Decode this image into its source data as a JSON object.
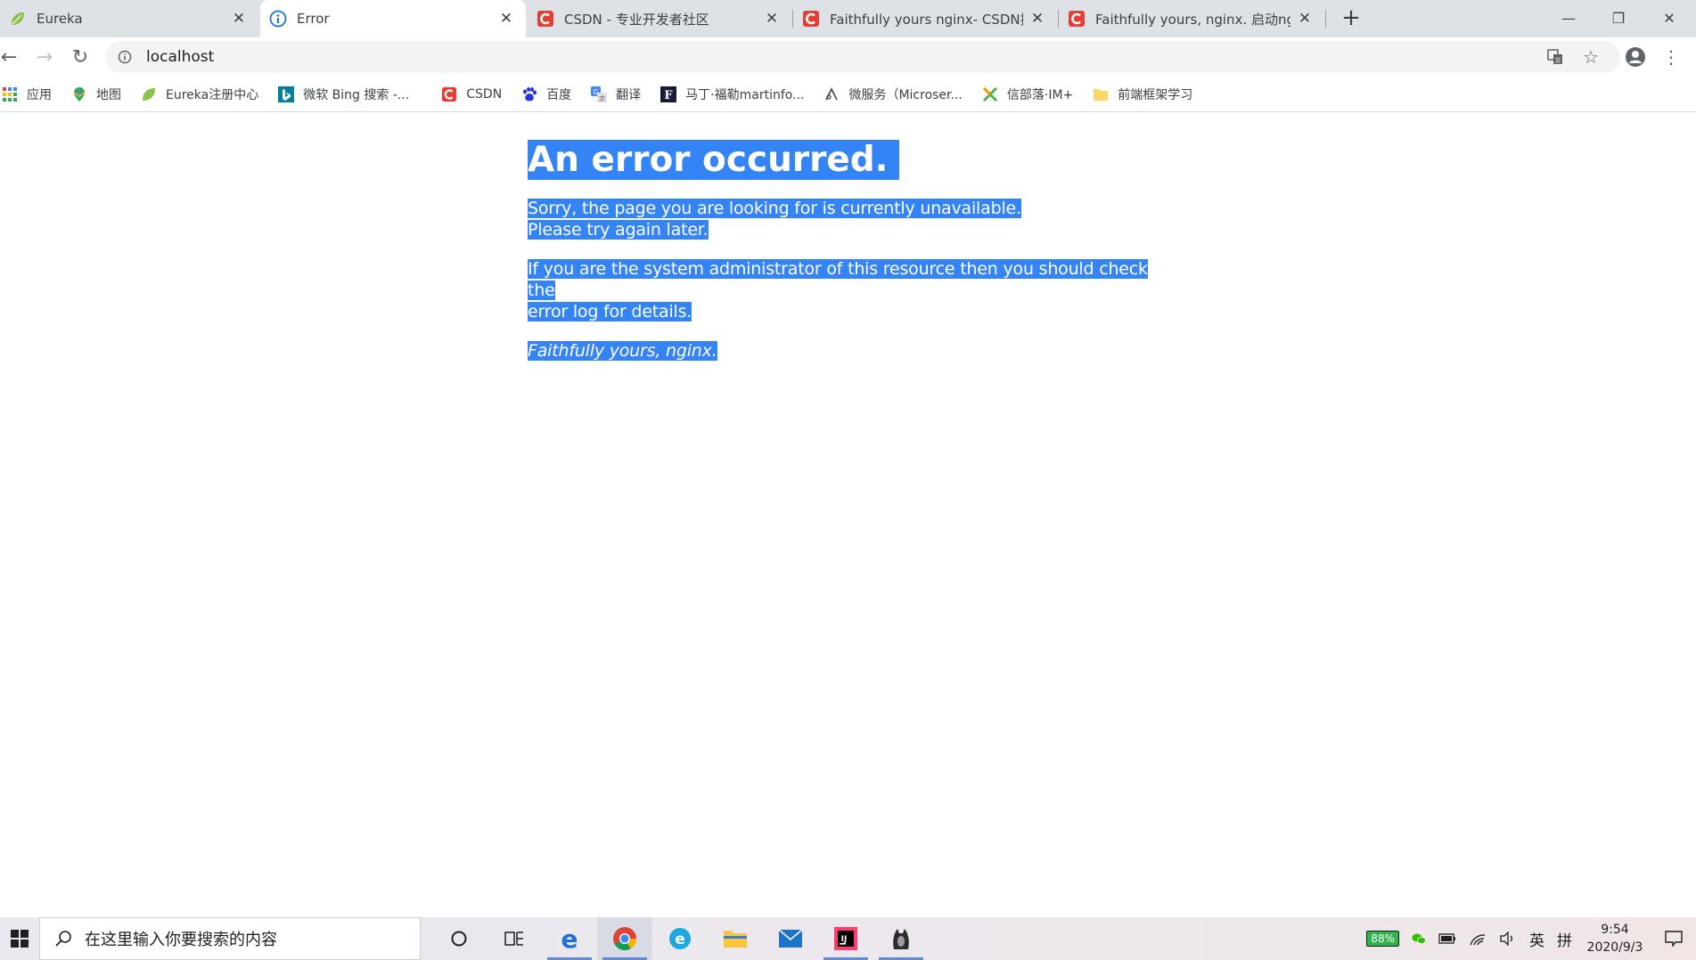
{
  "tabs": [
    {
      "title": "Eureka",
      "favicon": "leaf-icon",
      "active": false
    },
    {
      "title": "Error",
      "favicon": "globe-icon",
      "active": true
    },
    {
      "title": "CSDN - 专业开发者社区",
      "favicon": "csdn-icon",
      "active": false
    },
    {
      "title": "Faithfully yours nginx- CSDN搜",
      "favicon": "csdn-icon",
      "active": false
    },
    {
      "title": "Faithfully yours, nginx. 启动ngi",
      "favicon": "csdn-icon",
      "active": false
    }
  ],
  "new_tab_label": "+",
  "window_controls": {
    "minimize": "—",
    "restore": "❐",
    "close": "✕"
  },
  "toolbar": {
    "back": "←",
    "forward": "→",
    "reload": "↻",
    "url": "localhost"
  },
  "bookmarks": [
    {
      "label": "应用",
      "icon": "apps-grid-icon"
    },
    {
      "label": "地图",
      "icon": "maps-icon"
    },
    {
      "label": "Eureka注册中心",
      "icon": "leaf-icon"
    },
    {
      "label": "微软 Bing 搜索 -...",
      "icon": "bing-icon"
    },
    {
      "label": "CSDN",
      "icon": "csdn-icon"
    },
    {
      "label": "百度",
      "icon": "baidu-icon"
    },
    {
      "label": "翻译",
      "icon": "translate-icon"
    },
    {
      "label": "马丁·福勒martinfo...",
      "icon": "f-icon"
    },
    {
      "label": "微服务（Microser...",
      "icon": "microservice-icon"
    },
    {
      "label": "信部落·IM+",
      "icon": "im-icon"
    },
    {
      "label": "前端框架学习",
      "icon": "folder-icon"
    }
  ],
  "page": {
    "heading": "An error occurred.",
    "line1": "Sorry, the page you are looking for is currently unavailable.",
    "line2": "Please try again later.",
    "line3": "If you are the system administrator of this resource then you should check the",
    "line4": "error log for details.",
    "signature": "Faithfully yours, nginx."
  },
  "taskbar": {
    "search_placeholder": "在这里输入你要搜索的内容",
    "battery": "88%",
    "ime_lang": "英",
    "ime_mode": "拼",
    "time": "9:54",
    "date": "2020/9/3"
  },
  "colors": {
    "selection": "#3584f6",
    "tabstrip": "#dee1e6",
    "csdn_red": "#e33e33"
  }
}
